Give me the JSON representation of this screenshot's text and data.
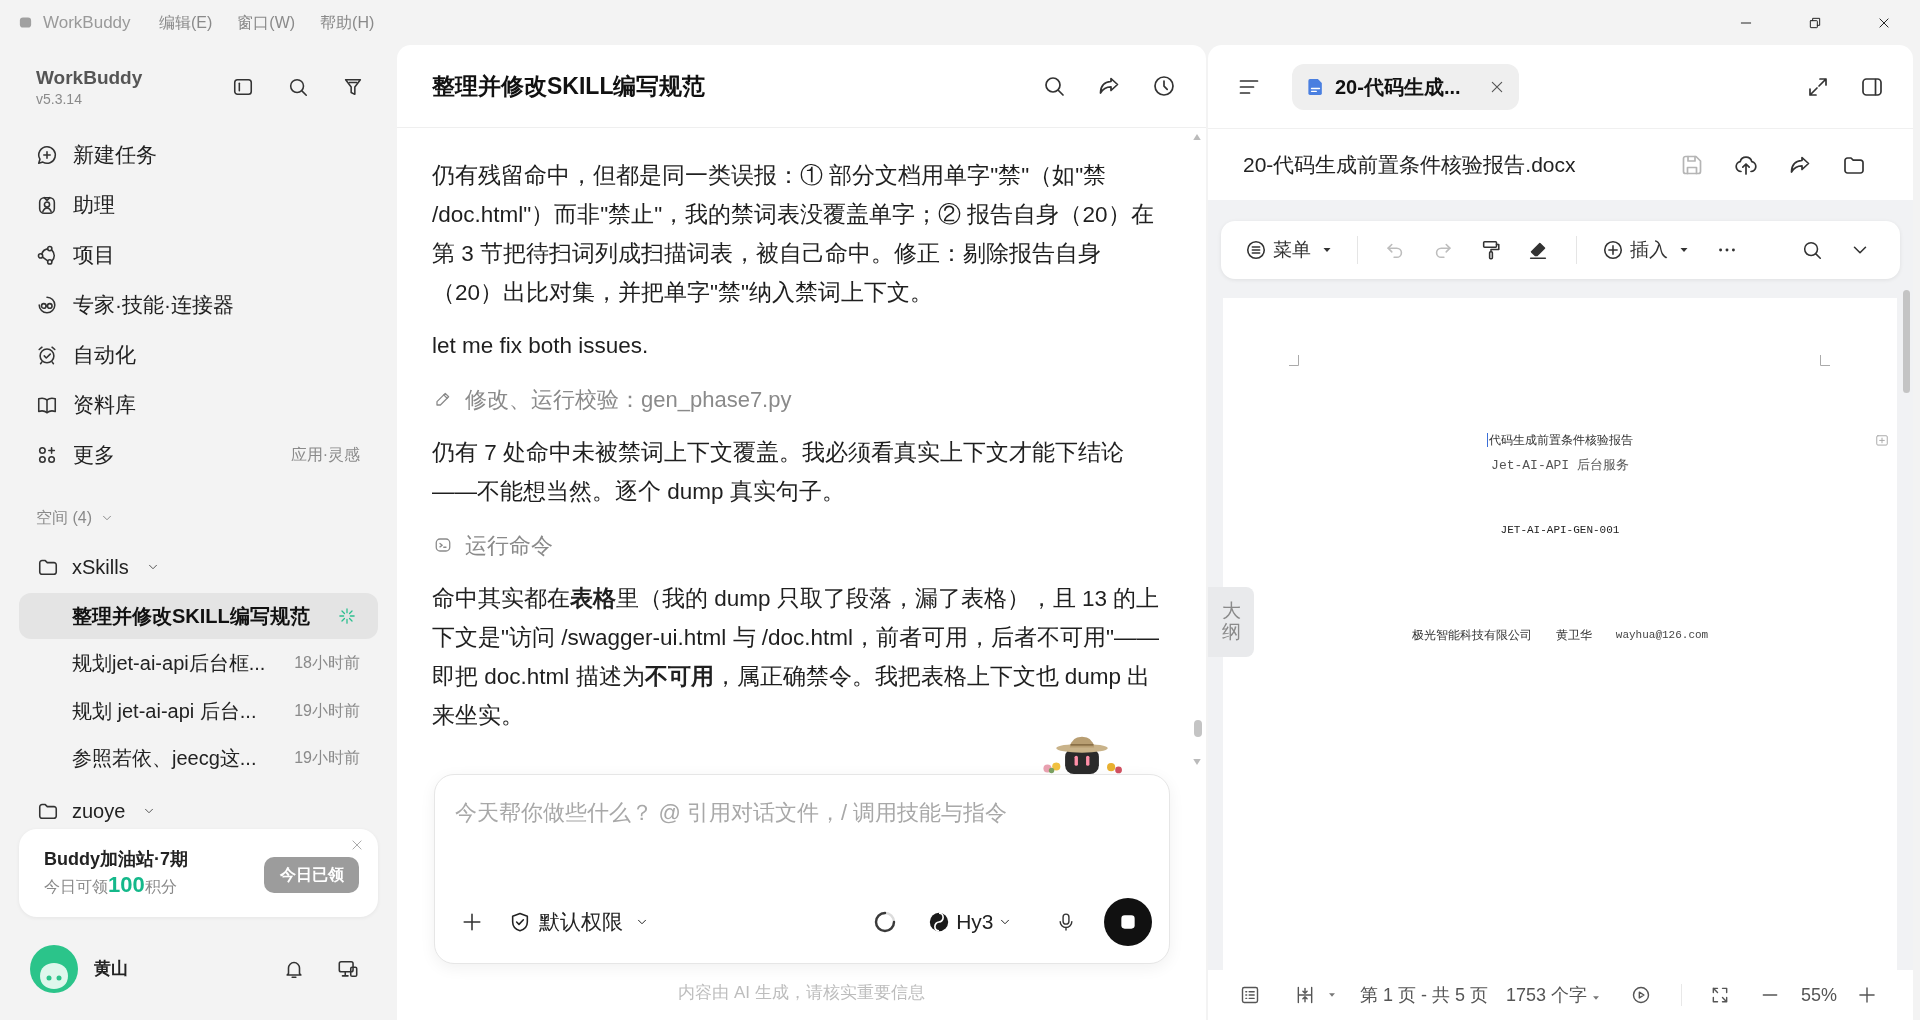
{
  "title_bar": {
    "app_name": "WorkBuddy",
    "menus": [
      {
        "label": "编辑(E)"
      },
      {
        "label": "窗口(W)"
      },
      {
        "label": "帮助(H)"
      }
    ]
  },
  "sidebar": {
    "app_name": "WorkBuddy",
    "version": "v5.3.14",
    "nav_items": [
      {
        "label": "新建任务"
      },
      {
        "label": "助理"
      },
      {
        "label": "项目"
      },
      {
        "label": "专家·技能·连接器"
      },
      {
        "label": "自动化"
      },
      {
        "label": "资料库"
      },
      {
        "label": "更多",
        "hint": "应用·灵感"
      }
    ],
    "spaces": {
      "label": "空间 (4)",
      "expanded": true,
      "folders": [
        {
          "name": "xSkills",
          "expanded": true,
          "tasks": [
            {
              "title": "整理并修改SKILL编写规范",
              "selected": true,
              "running": true
            },
            {
              "title": "规划jet-ai-api后台框...",
              "time": "18小时前",
              "selected": false,
              "running": false
            },
            {
              "title": "规划 jet-ai-api 后台...",
              "time": "19小时前",
              "selected": false,
              "running": false
            },
            {
              "title": "参照若依、jeecg这...",
              "time": "19小时前",
              "selected": false,
              "running": false
            }
          ]
        },
        {
          "name": "zuoye",
          "expanded": true
        }
      ]
    },
    "promo": {
      "title": "Buddy加油站·7期",
      "reward_prefix": "今日可领",
      "reward_amount": "100",
      "reward_suffix": "积分",
      "button": {
        "label": "今日已领",
        "disabled": true
      }
    },
    "user": {
      "name": "黄山"
    }
  },
  "chat": {
    "title": "整理并修改SKILL编写规范",
    "messages": [
      {
        "kind": "text",
        "text": "仍有残留命中，但都是同一类误报：① 部分文档用单字\"禁\"（如\"禁 /doc.html\"）而非\"禁止\"，我的禁词表没覆盖单字；② 报告自身（20）在第 3 节把待扫词列成扫描词表，被自己命中。修正：剔除报告自身（20）出比对集，并把单字\"禁\"纳入禁词上下文。"
      },
      {
        "kind": "text",
        "text": "let me fix both issues."
      },
      {
        "kind": "edit",
        "text": "修改、运行校验：gen_phase7.py"
      },
      {
        "kind": "text",
        "text": "仍有 7 处命中未被禁词上下文覆盖。我必须看真实上下文才能下结论——不能想当然。逐个 dump 真实句子。"
      },
      {
        "kind": "command",
        "text": "运行命令"
      },
      {
        "kind": "text",
        "text": "命中其实都在**表格**里（我的 dump 只取了段落，漏了表格），且 13 的上下文是\"访问 /swagger-ui.html 与 /doc.html，前者可用，后者不可用\"——即把 doc.html 描述为**不可用**，属正确禁令。我把表格上下文也 dump 出来坐实。"
      }
    ],
    "composer": {
      "placeholder": "今天帮你做些什么？ @ 引用对话文件，/ 调用技能与指令",
      "permission": "默认权限",
      "model": "Hy3",
      "generating": true
    },
    "disclaimer": "内容由 AI 生成，请核实重要信息"
  },
  "document": {
    "tabs": [
      {
        "title": "20-代码生成...",
        "selected": true
      }
    ],
    "file_name": "20-代码生成前置条件核验报告.docx",
    "save": {
      "disabled": true
    },
    "toolbar": {
      "menu": "菜单",
      "insert": "插入",
      "undo": {
        "disabled": true
      },
      "redo": {
        "disabled": true
      }
    },
    "page": {
      "title": "代码生成前置条件核验报告",
      "subtitle": "Jet-AI-API 后台服务",
      "doc_number": "JET-AI-API-GEN-001",
      "company": "极光智能科技有限公司",
      "author": "黄卫华",
      "email": "wayhua@126.com"
    },
    "outline_tab": "大纲",
    "status_bar": {
      "page_info": "第 1 页 - 共 5 页",
      "word_count": "1753 个字",
      "zoom": "55%"
    }
  }
}
